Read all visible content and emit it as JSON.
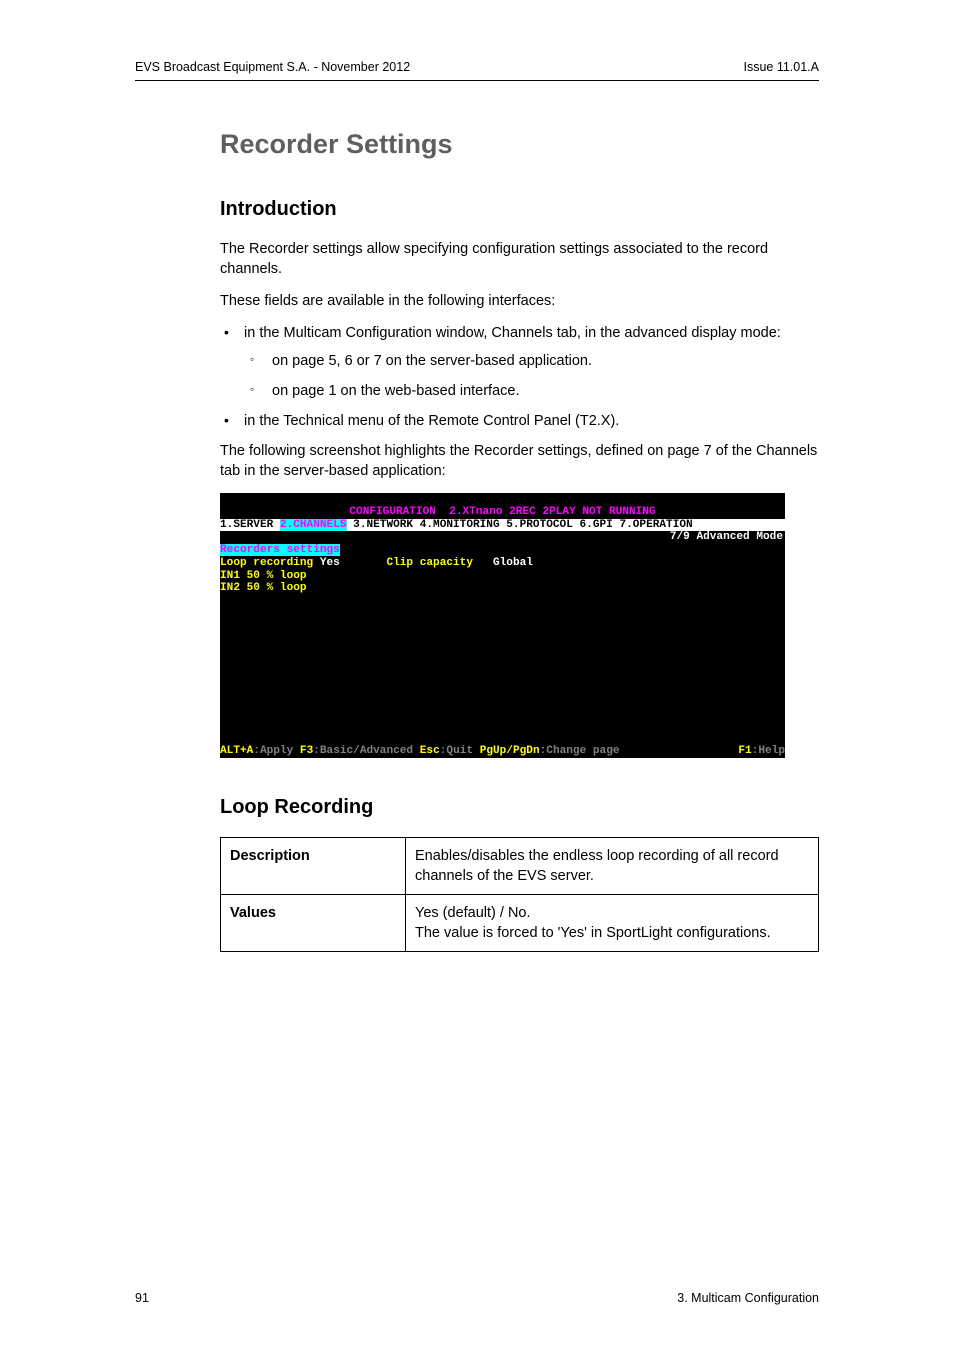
{
  "header": {
    "left": "EVS Broadcast Equipment S.A.  - November 2012",
    "right": "Issue 11.01.A"
  },
  "title": "Recorder Settings",
  "intro_heading": "Introduction",
  "p1": "The Recorder settings allow specifying configuration settings associated to the record channels.",
  "p2": "These fields are available in the following interfaces:",
  "bullets": {
    "b1": "in the Multicam Configuration window, Channels tab, in the advanced display mode:",
    "b1a": "on page 5, 6 or 7 on the server-based application.",
    "b1b": "on page 1 on the web-based interface.",
    "b2": "in the Technical menu of the Remote Control Panel (T2.X)."
  },
  "p3": "The following screenshot highlights the Recorder settings, defined on page 7 of the Channels tab in the server-based application:",
  "terminal": {
    "title": "CONFIGURATION  2.XTnano 2REC 2PLAY NOT RUNNING",
    "menu_left": "1.SERVER ",
    "menu_sel": "2.CHANNELS",
    "menu_right": " 3.NETWORK 4.MONITORING 5.PROTOCOL 6.GPI 7.OPERATION",
    "page_indicator": "7/9 Advanced Mode",
    "section": "Recorders settings",
    "line1_a": "Loop recording",
    "line1_b": " Yes       ",
    "line1_c": "Clip capacity   ",
    "line1_d": "Global",
    "line2": "IN1 50 % loop",
    "line3": "IN2 50 % loop",
    "footer_k1": "ALT+A",
    "footer_t1": ":Apply ",
    "footer_k2": "F3",
    "footer_t2": ":Basic/Advanced ",
    "footer_k3": "Esc",
    "footer_t3": ":Quit ",
    "footer_k4": "PgUp/PgDn",
    "footer_t4": ":Change page",
    "footer_k5": "F1",
    "footer_t5": ":Help"
  },
  "loop_heading": "Loop Recording",
  "table": {
    "r1label": "Description",
    "r1value": "Enables/disables the endless loop recording of all record channels of the EVS server.",
    "r2label": "Values",
    "r2value_l1": "Yes (default) / No.",
    "r2value_l2": "The value is forced to 'Yes' in SportLight configurations."
  },
  "footer": {
    "left": "91",
    "right": "3. Multicam Configuration"
  }
}
